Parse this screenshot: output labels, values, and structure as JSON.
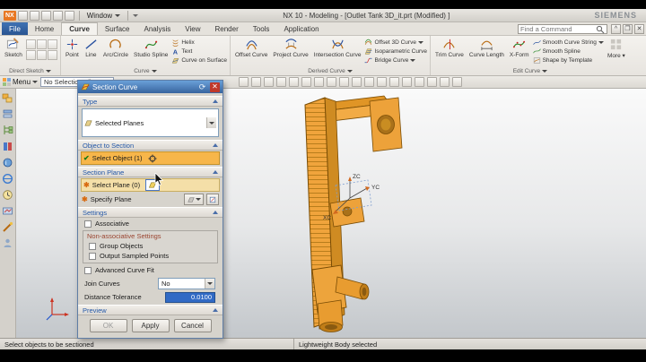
{
  "titlebar": {
    "logo": "NX",
    "window_menu": "Window",
    "title": "NX 10 - Modeling - [Outlet Tank 3D_it.prt (Modified) ]",
    "brand": "SIEMENS"
  },
  "tabs": [
    "File",
    "Home",
    "Curve",
    "Surface",
    "Analysis",
    "View",
    "Render",
    "Tools",
    "Application"
  ],
  "find_command": {
    "placeholder": "Find a Command"
  },
  "ribbon": {
    "direct_sketch": {
      "group": "Direct Sketch",
      "sketch": "Sketch"
    },
    "curve": {
      "group": "Curve",
      "point": "Point",
      "line": "Line",
      "arc": "Arc/Circle",
      "spline": "Studio Spline",
      "helix": "Helix",
      "text": "Text",
      "curve_on_surface": "Curve on Surface"
    },
    "derived": {
      "group": "Derived Curve",
      "offset": "Offset Curve",
      "project": "Project Curve",
      "intersection": "Intersection Curve",
      "offset3d": "Offset 3D Curve",
      "isoparametric": "Isoparametric Curve",
      "bridge": "Bridge Curve"
    },
    "edit": {
      "group": "Edit Curve",
      "trim": "Trim Curve",
      "length": "Curve Length",
      "xform": "X-Form",
      "smooth_string": "Smooth Curve String",
      "smooth_spline": "Smooth Spline",
      "shape_template": "Shape by Template",
      "more": "More"
    }
  },
  "toolbar": {
    "menu": "Menu",
    "selection_filter": "No Selection Filter"
  },
  "dialog": {
    "title": "Section Curve",
    "type_header": "Type",
    "type_value": "Selected Planes",
    "object_header": "Object to Section",
    "select_object": "Select Object (1)",
    "plane_header": "Section Plane",
    "select_plane": "Select Plane (0)",
    "specify_plane": "Specify Plane",
    "settings_header": "Settings",
    "associative": "Associative",
    "non_associative_header": "Non-associative Settings",
    "group_objects": "Group Objects",
    "output_sampled_points": "Output Sampled Points",
    "advanced_curve_fit": "Advanced Curve Fit",
    "join_curves": "Join Curves",
    "join_curves_value": "No",
    "distance_tolerance": "Distance Tolerance",
    "distance_tolerance_value": "0.0100",
    "preview_header": "Preview",
    "ok": "OK",
    "apply": "Apply",
    "cancel": "Cancel"
  },
  "viewport": {
    "axis_z": "ZC",
    "axis_y": "YC",
    "axis_x": "XC"
  },
  "statusbar": {
    "left": "Select objects to be sectioned",
    "right": "Lightweight Body selected"
  },
  "colors": {
    "model_orange": "#f0a43c",
    "highlight_orange": "#f7b64a",
    "selection_blue": "#316ac5",
    "dialog_title_blue": "#38659f",
    "brand_gray": "#8a8f94"
  }
}
